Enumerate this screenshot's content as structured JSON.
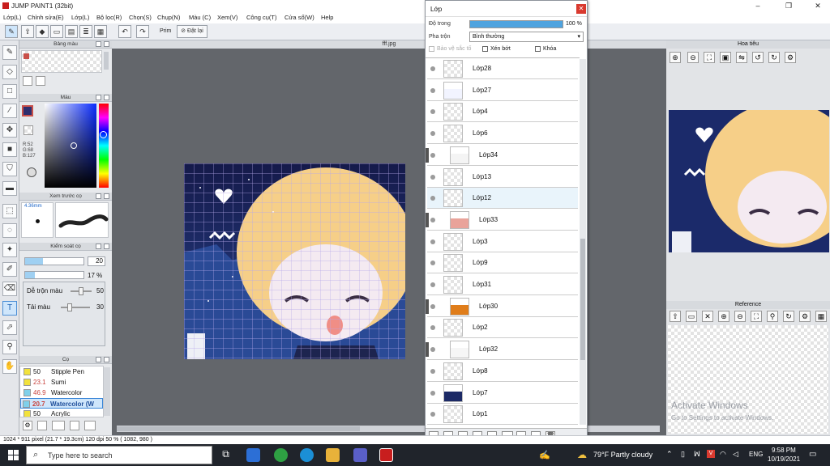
{
  "window": {
    "title": "JUMP PAINT1 (32bit)",
    "doc_tab": "fff.jpg"
  },
  "menu": [
    "Lớp(L)",
    "Chỉnh sửa(E)",
    "Lớp(L)",
    "Bộ lọc(R)",
    "Chọn(S)",
    "Chụp(N)",
    "Màu (C)",
    "Xem(V)",
    "Công cụ(T)",
    "Cửa sổ(W)",
    "Help"
  ],
  "toolbar": {
    "prism_label": "Prim",
    "cancel_label": "Đặt lại"
  },
  "panels": {
    "palette": "Bảng màu",
    "color": "Màu",
    "preview": "Xem trước cọ",
    "brush_control": "Kiểm soát cọ",
    "brush_list": "Cọ",
    "navigator": "Hoa tiêu",
    "reference": "Reference"
  },
  "colors": {
    "fg": "#2e2e6e",
    "accent": "#1e66c8",
    "primary_swatch": "#c9504a"
  },
  "color_values": {
    "r": "R:52",
    "g": "G:68",
    "b": "B:127"
  },
  "preview": {
    "size": "4.36mm"
  },
  "brush_control": {
    "size": "20",
    "density": "17 %",
    "size_pct": 0.3,
    "density_pct": 0.17,
    "blend_label": "Dễ trộn màu",
    "blend_value": "50",
    "mix_label": "Tải màu",
    "mix_value": "30"
  },
  "brushes": [
    {
      "size": "50",
      "name": "Stipple Pen",
      "selected": false
    },
    {
      "size": "23.1",
      "name": "Sumi",
      "selected": false
    },
    {
      "size": "46.9",
      "name": "Watercolor",
      "selected": false
    },
    {
      "size": "20.7",
      "name": "Watercolor (W",
      "selected": true
    },
    {
      "size": "50",
      "name": "Acrylic",
      "selected": false
    }
  ],
  "layers": {
    "title": "Lớp",
    "opacity_label": "Độ trong",
    "opacity_value": "100 %",
    "opacity": 1.0,
    "blend_label": "Pha trộn",
    "blend_value": "Bình thường",
    "protect_label": "Bảo vệ sắc tố",
    "clip_label": "Xén bớt",
    "lock_label": "Khóa",
    "items": [
      {
        "name": "Lớp28",
        "clipped": false,
        "selected": false
      },
      {
        "name": "Lớp27",
        "clipped": false,
        "selected": false
      },
      {
        "name": "Lớp4",
        "clipped": false,
        "selected": false
      },
      {
        "name": "Lớp6",
        "clipped": false,
        "selected": false
      },
      {
        "name": "Lớp34",
        "clipped": true,
        "selected": false
      },
      {
        "name": "Lớp13",
        "clipped": false,
        "selected": false
      },
      {
        "name": "Lớp12",
        "clipped": false,
        "selected": true
      },
      {
        "name": "Lớp33",
        "clipped": true,
        "selected": false
      },
      {
        "name": "Lớp3",
        "clipped": false,
        "selected": false
      },
      {
        "name": "Lớp9",
        "clipped": false,
        "selected": false
      },
      {
        "name": "Lớp31",
        "clipped": false,
        "selected": false
      },
      {
        "name": "Lớp30",
        "clipped": true,
        "selected": false
      },
      {
        "name": "Lớp2",
        "clipped": false,
        "selected": false
      },
      {
        "name": "Lớp32",
        "clipped": true,
        "selected": false
      },
      {
        "name": "Lớp8",
        "clipped": false,
        "selected": false
      },
      {
        "name": "Lớp7",
        "clipped": false,
        "selected": false
      },
      {
        "name": "Lớp1",
        "clipped": false,
        "selected": false
      }
    ]
  },
  "status": {
    "text": "1024 * 911 pixel   (21.7 * 19.3cm)   120 dpi   50 %   ( 1082, 980 )"
  },
  "watermark": {
    "line1": "Activate Windows",
    "line2": "Go to Settings to activate Windows."
  },
  "taskbar": {
    "search_placeholder": "Type here to search",
    "weather": "79°F  Partly cloudy",
    "lang": "ENG",
    "time": "9:58 PM",
    "date": "10/19/2021"
  }
}
